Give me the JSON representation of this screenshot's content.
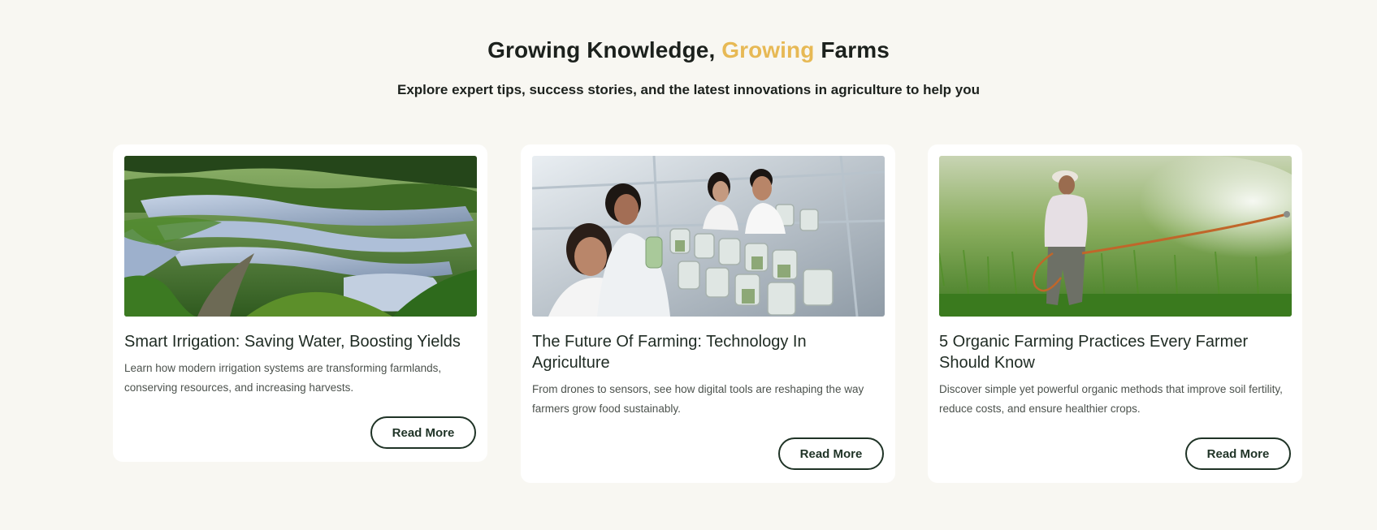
{
  "header": {
    "title_part1": "Growing Knowledge, ",
    "title_highlight": "Growing",
    "title_part2": " Farms",
    "subtitle": "Explore expert tips, success stories, and the latest innovations in agriculture to help you",
    "highlight_color": "#e7b955"
  },
  "cards": [
    {
      "image": "rice-terraces-photo",
      "title": "Smart Irrigation: Saving Water, Boosting Yields",
      "description": "Learn how modern irrigation systems are transforming farmlands, conserving resources, and increasing harvests.",
      "button_label": "Read More"
    },
    {
      "image": "lab-researchers-photo",
      "title": "The Future Of Farming: Technology In Agriculture",
      "description": "From drones to sensors, see how digital tools are reshaping the way farmers grow food sustainably.",
      "button_label": "Read More"
    },
    {
      "image": "farmer-spraying-photo",
      "title": "5 Organic Farming Practices Every Farmer Should Know",
      "description": "Discover simple yet powerful organic methods that improve soil fertility, reduce costs, and ensure healthier crops.",
      "button_label": "Read More"
    }
  ]
}
